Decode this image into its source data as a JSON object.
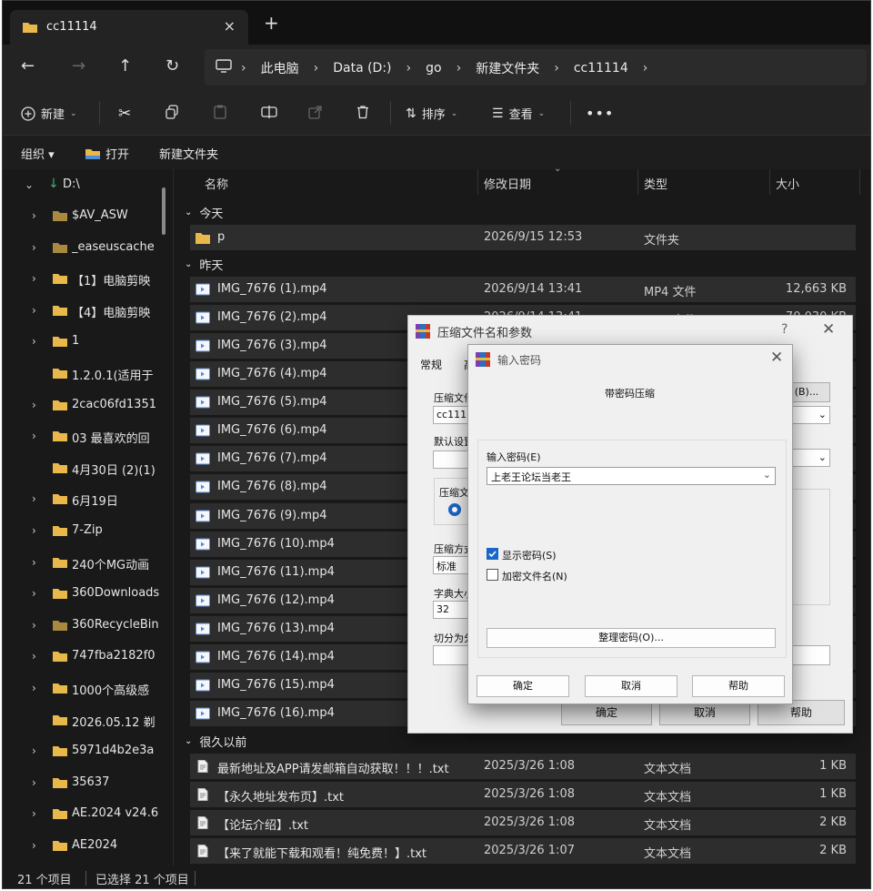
{
  "tab": {
    "title": "cc11114",
    "close_icon": "×"
  },
  "nav": {
    "breadcrumbs": [
      "此电脑",
      "Data (D:)",
      "go",
      "新建文件夹",
      "cc11114"
    ]
  },
  "toolbar": {
    "new_label": "新建",
    "sort_label": "排序",
    "view_label": "查看"
  },
  "cmdbar": {
    "organize": "组织 ▾",
    "open": "打开",
    "new_folder": "新建文件夹"
  },
  "sidebar": {
    "drive": "D:\\",
    "items": [
      {
        "name": "$AV_ASW",
        "chev": true,
        "dim": true
      },
      {
        "name": "_easeuscache",
        "chev": true,
        "dim": true
      },
      {
        "name": "【1】电脑剪映",
        "chev": true
      },
      {
        "name": "【4】电脑剪映",
        "chev": true
      },
      {
        "name": "1",
        "chev": true
      },
      {
        "name": "1.2.0.1(适用于",
        "chev": false
      },
      {
        "name": "2cac06fd1351",
        "chev": true
      },
      {
        "name": "03 最喜欢的回",
        "chev": true
      },
      {
        "name": "4月30日 (2)(1)",
        "chev": false
      },
      {
        "name": "6月19日",
        "chev": true
      },
      {
        "name": "7-Zip",
        "chev": true
      },
      {
        "name": "240个MG动画",
        "chev": true
      },
      {
        "name": "360Downloads",
        "chev": true
      },
      {
        "name": "360RecycleBin",
        "chev": true,
        "dim": true
      },
      {
        "name": "747fba2182f0",
        "chev": true
      },
      {
        "name": "1000个高级感",
        "chev": true
      },
      {
        "name": "2026.05.12 剃",
        "chev": false
      },
      {
        "name": "5971d4b2e3a",
        "chev": true
      },
      {
        "name": "35637",
        "chev": true
      },
      {
        "name": "AE.2024 v24.6",
        "chev": true
      },
      {
        "name": "AE2024",
        "chev": true
      }
    ]
  },
  "columns": {
    "name": "名称",
    "date": "修改日期",
    "type": "类型",
    "size": "大小"
  },
  "groups": {
    "today": "今天",
    "yesterday": "昨天",
    "long_ago": "很久以前"
  },
  "files_today": [
    {
      "name": "p",
      "date": "2026/9/15 12:53",
      "type": "文件夹",
      "size": ""
    }
  ],
  "files_yesterday": [
    {
      "name": "IMG_7676 (1).mp4",
      "date": "2026/9/14 13:41",
      "type": "MP4 文件",
      "size": "12,663 KB"
    },
    {
      "name": "IMG_7676 (2).mp4",
      "date": "2026/9/14 13:41",
      "type": "MP4 文件",
      "size": "70,030 KB"
    },
    {
      "name": "IMG_7676 (3).mp4",
      "date": "",
      "type": "",
      "size": ""
    },
    {
      "name": "IMG_7676 (4).mp4",
      "date": "",
      "type": "",
      "size": ""
    },
    {
      "name": "IMG_7676 (5).mp4",
      "date": "",
      "type": "",
      "size": ""
    },
    {
      "name": "IMG_7676 (6).mp4",
      "date": "",
      "type": "",
      "size": ""
    },
    {
      "name": "IMG_7676 (7).mp4",
      "date": "",
      "type": "",
      "size": ""
    },
    {
      "name": "IMG_7676 (8).mp4",
      "date": "",
      "type": "",
      "size": ""
    },
    {
      "name": "IMG_7676 (9).mp4",
      "date": "",
      "type": "",
      "size": ""
    },
    {
      "name": "IMG_7676 (10).mp4",
      "date": "",
      "type": "",
      "size": ""
    },
    {
      "name": "IMG_7676 (11).mp4",
      "date": "",
      "type": "",
      "size": ""
    },
    {
      "name": "IMG_7676 (12).mp4",
      "date": "",
      "type": "",
      "size": ""
    },
    {
      "name": "IMG_7676 (13).mp4",
      "date": "",
      "type": "",
      "size": ""
    },
    {
      "name": "IMG_7676 (14).mp4",
      "date": "",
      "type": "",
      "size": ""
    },
    {
      "name": "IMG_7676 (15).mp4",
      "date": "",
      "type": "",
      "size": ""
    },
    {
      "name": "IMG_7676 (16).mp4",
      "date": "",
      "type": "",
      "size": ""
    }
  ],
  "files_old": [
    {
      "name": "最新地址及APP请发邮箱自动获取！！！.txt",
      "date": "2025/3/26 1:08",
      "type": "文本文档",
      "size": "1 KB"
    },
    {
      "name": "【永久地址发布页】.txt",
      "date": "2025/3/26 1:08",
      "type": "文本文档",
      "size": "1 KB"
    },
    {
      "name": "【论坛介绍】.txt",
      "date": "2025/3/26 1:08",
      "type": "文本文档",
      "size": "2 KB"
    },
    {
      "name": "【来了就能下载和观看！纯免费！】.txt",
      "date": "2025/3/26 1:07",
      "type": "文本文档",
      "size": "2 KB"
    }
  ],
  "status": {
    "count": "21 个项目",
    "selected": "已选择 21 个项目"
  },
  "archive_dialog": {
    "title": "压缩文件名和参数",
    "help_q": "?",
    "tab_general": "常规",
    "tab_adv": "高",
    "archive_name_label": "压缩文件",
    "archive_name_value": "cc111",
    "browse_btn": "(B)...",
    "default_label": "默认设置",
    "format_label": "压缩文",
    "method_label": "压缩方式",
    "method_value": "标准",
    "dict_label": "字典大小",
    "dict_value": "32",
    "split_label": "切分为分",
    "ok": "确定",
    "cancel": "取消",
    "help": "帮助"
  },
  "password_dialog": {
    "title": "输入密码",
    "heading": "带密码压缩",
    "enter_label": "输入密码(E)",
    "password_value": "上老王论坛当老王",
    "show_password": "显示密码(S)",
    "encrypt_names": "加密文件名(N)",
    "organize_btn": "整理密码(O)...",
    "ok": "确定",
    "cancel": "取消",
    "help": "帮助"
  },
  "colors": {
    "folder": "#e9b84a",
    "accent": "#1a66c8",
    "video_icon": "#5b86c9"
  }
}
